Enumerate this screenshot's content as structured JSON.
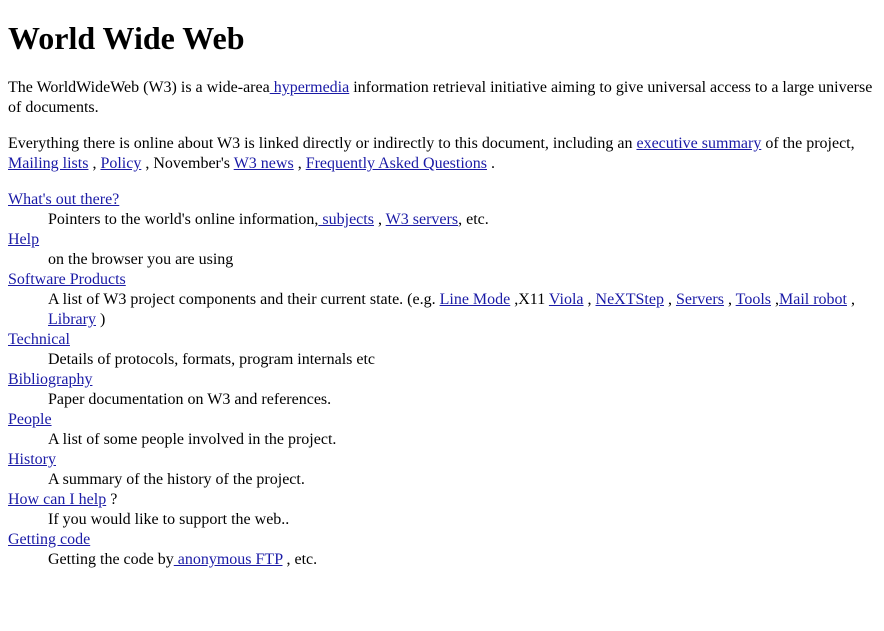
{
  "title": "World Wide Web",
  "colors": {
    "link": "#1a1aa6",
    "text": "#000000",
    "background": "#ffffff"
  },
  "paragraphs": [
    [
      {
        "text": "The WorldWideWeb (W3) is a wide-area"
      },
      {
        "text": " hypermedia",
        "link": true
      },
      {
        "text": " information retrieval initiative aiming to give universal access to a large universe of documents."
      }
    ],
    [
      {
        "text": "Everything there is online about W3 is linked directly or indirectly to this document, including an "
      },
      {
        "text": "executive summary",
        "link": true
      },
      {
        "text": " of the project, "
      },
      {
        "text": "Mailing lists",
        "link": true
      },
      {
        "text": " , "
      },
      {
        "text": "Policy",
        "link": true
      },
      {
        "text": " , November's "
      },
      {
        "text": "W3 news",
        "link": true
      },
      {
        "text": " , "
      },
      {
        "text": "Frequently Asked Questions",
        "link": true
      },
      {
        "text": " ."
      }
    ]
  ],
  "entries": [
    {
      "term": [
        {
          "text": "What's out there?",
          "link": true
        }
      ],
      "desc": [
        {
          "text": "Pointers to the world's online information,"
        },
        {
          "text": " subjects",
          "link": true
        },
        {
          "text": " , "
        },
        {
          "text": "W3 servers",
          "link": true
        },
        {
          "text": ", etc."
        }
      ]
    },
    {
      "term": [
        {
          "text": "Help",
          "link": true
        }
      ],
      "desc": [
        {
          "text": "on the browser you are using"
        }
      ]
    },
    {
      "term": [
        {
          "text": "Software Products",
          "link": true
        }
      ],
      "desc": [
        {
          "text": "A list of W3 project components and their current state. (e.g. "
        },
        {
          "text": "Line Mode",
          "link": true
        },
        {
          "text": " ,X11 "
        },
        {
          "text": "Viola",
          "link": true
        },
        {
          "text": " , "
        },
        {
          "text": "NeXTStep",
          "link": true
        },
        {
          "text": " , "
        },
        {
          "text": "Servers",
          "link": true
        },
        {
          "text": " , "
        },
        {
          "text": "Tools",
          "link": true
        },
        {
          "text": " ,"
        },
        {
          "text": "Mail robot",
          "link": true
        },
        {
          "text": " , "
        },
        {
          "text": "Library",
          "link": true
        },
        {
          "text": " )"
        }
      ]
    },
    {
      "term": [
        {
          "text": "Technical",
          "link": true
        }
      ],
      "desc": [
        {
          "text": "Details of protocols, formats, program internals etc"
        }
      ]
    },
    {
      "term": [
        {
          "text": "Bibliography",
          "link": true
        }
      ],
      "desc": [
        {
          "text": "Paper documentation on W3 and references."
        }
      ]
    },
    {
      "term": [
        {
          "text": "People",
          "link": true
        }
      ],
      "desc": [
        {
          "text": "A list of some people involved in the project."
        }
      ]
    },
    {
      "term": [
        {
          "text": "History",
          "link": true
        }
      ],
      "desc": [
        {
          "text": "A summary of the history of the project."
        }
      ]
    },
    {
      "term": [
        {
          "text": "How can I help",
          "link": true
        },
        {
          "text": " ?"
        }
      ],
      "desc": [
        {
          "text": "If you would like to support the web.."
        }
      ]
    },
    {
      "term": [
        {
          "text": "Getting code",
          "link": true
        }
      ],
      "desc": [
        {
          "text": "Getting the code by"
        },
        {
          "text": " anonymous FTP",
          "link": true
        },
        {
          "text": " , etc."
        }
      ]
    }
  ]
}
